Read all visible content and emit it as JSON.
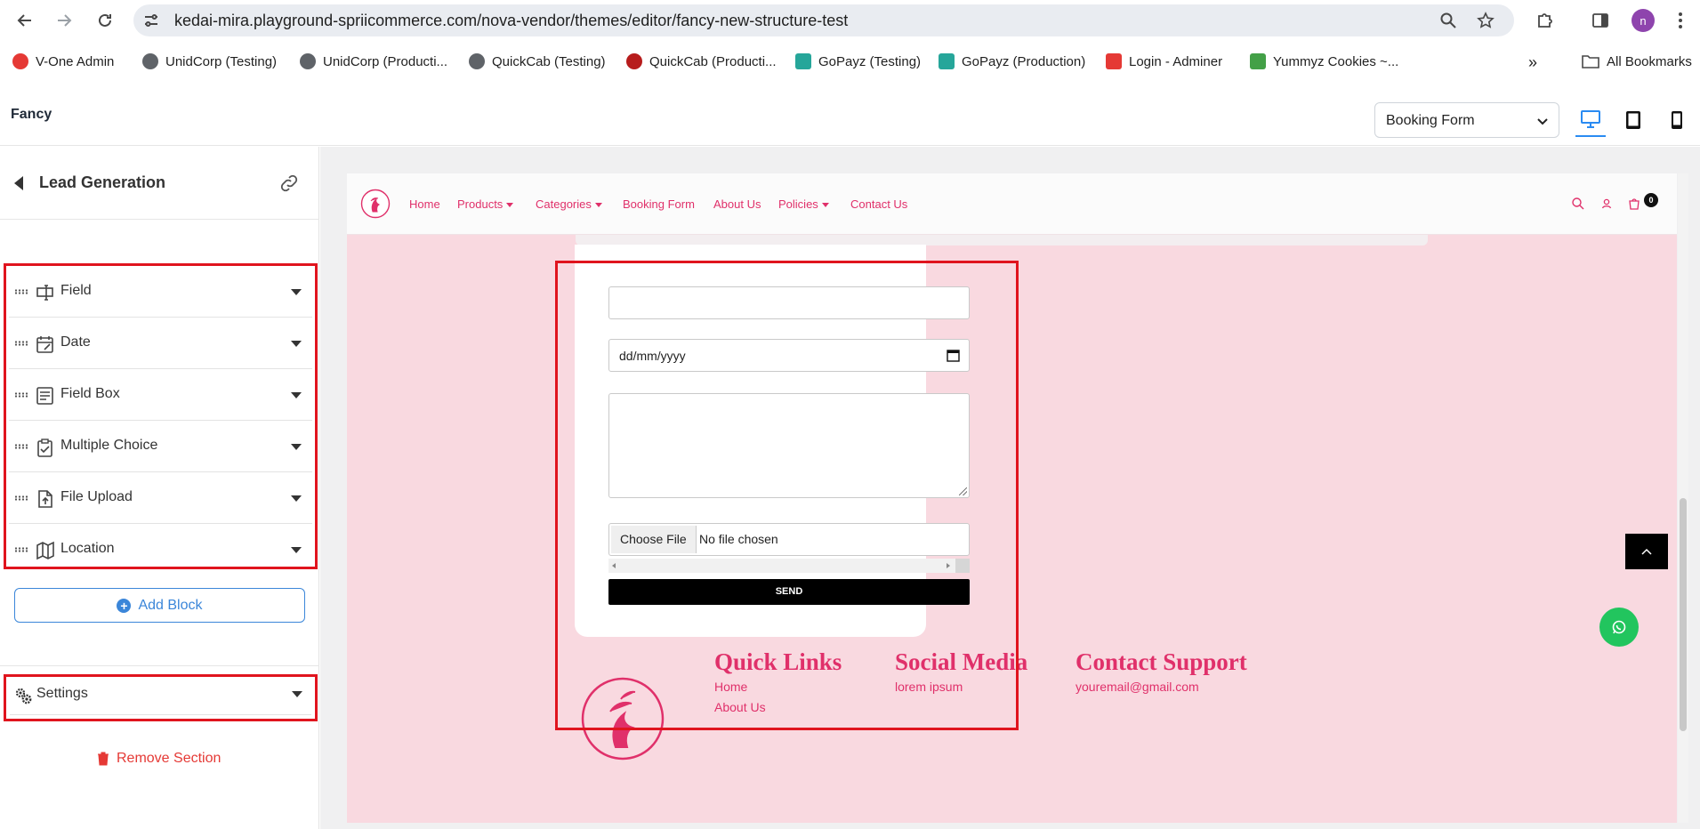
{
  "browser": {
    "url": "kedai-mira.playground-spriicommerce.com/nova-vendor/themes/editor/fancy-new-structure-test",
    "profile_initial": "n",
    "bookmarks": [
      {
        "label": "V-One Admin",
        "color": "#e53935"
      },
      {
        "label": "UnidCorp (Testing)",
        "color": "#5f6368"
      },
      {
        "label": "UnidCorp (Producti...",
        "color": "#5f6368"
      },
      {
        "label": "QuickCab (Testing)",
        "color": "#5f6368"
      },
      {
        "label": "QuickCab (Producti...",
        "color": "#b71c1c"
      },
      {
        "label": "GoPayz (Testing)",
        "color": "#26a69a"
      },
      {
        "label": "GoPayz (Production)",
        "color": "#26a69a"
      },
      {
        "label": "Login - Adminer",
        "color": "#e53935"
      },
      {
        "label": "Yummyz Cookies ~...",
        "color": "#43a047"
      }
    ],
    "all_bookmarks": "All Bookmarks"
  },
  "editor": {
    "app_title": "Fancy",
    "page_select": "Booking Form",
    "devices": [
      "desktop-icon",
      "tablet-icon",
      "mobile-icon"
    ],
    "active_device": "desktop"
  },
  "sidebar": {
    "section_title": "Lead Generation",
    "blocks": [
      {
        "label": "Field",
        "icon": "field-icon"
      },
      {
        "label": "Date",
        "icon": "date-icon"
      },
      {
        "label": "Field Box",
        "icon": "field-box-icon"
      },
      {
        "label": "Multiple Choice",
        "icon": "multiple-choice-icon"
      },
      {
        "label": "File Upload",
        "icon": "file-upload-icon"
      },
      {
        "label": "Location",
        "icon": "location-icon"
      }
    ],
    "add_block": "Add Block",
    "settings": "Settings",
    "remove_section": "Remove Section"
  },
  "preview": {
    "nav": {
      "links": [
        "Home",
        "Products",
        "Categories",
        "Booking Form",
        "About Us",
        "Policies",
        "Contact Us"
      ],
      "cart_count": "0"
    },
    "form": {
      "date_placeholder": "dd/mm/yyyy",
      "choose_file": "Choose File",
      "no_file": "No file chosen",
      "send": "SEND"
    },
    "footer": {
      "quick_links_title": "Quick Links",
      "quick_links": [
        "Home",
        "About Us"
      ],
      "social_title": "Social Media",
      "social_text": "lorem ipsum",
      "contact_title": "Contact Support",
      "contact_email": "youremail@gmail.com"
    }
  },
  "colors": {
    "accent": "#e0306a",
    "highlight": "#e0141e",
    "link_blue": "#3b86d9",
    "preview_bg": "#f9d9e0"
  }
}
